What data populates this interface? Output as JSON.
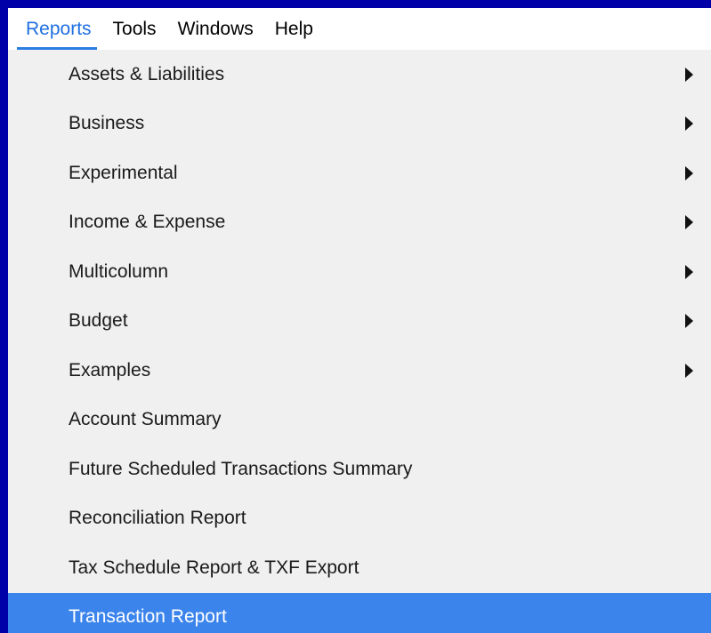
{
  "menubar": {
    "items": [
      {
        "label": "Reports",
        "active": true
      },
      {
        "label": "Tools",
        "active": false
      },
      {
        "label": "Windows",
        "active": false
      },
      {
        "label": "Help",
        "active": false
      }
    ]
  },
  "reports_menu": {
    "items": [
      {
        "label": "Assets & Liabilities",
        "has_submenu": true
      },
      {
        "label": "Business",
        "has_submenu": true
      },
      {
        "label": "Experimental",
        "has_submenu": true
      },
      {
        "label": "Income & Expense",
        "has_submenu": true
      },
      {
        "label": "Multicolumn",
        "has_submenu": true
      },
      {
        "label": "Budget",
        "has_submenu": true
      },
      {
        "label": "Examples",
        "has_submenu": true
      },
      {
        "label": "Account Summary",
        "has_submenu": false
      },
      {
        "label": "Future Scheduled Transactions Summary",
        "has_submenu": false
      },
      {
        "label": "Reconciliation Report",
        "has_submenu": false
      },
      {
        "label": "Tax Schedule Report & TXF Export",
        "has_submenu": false
      },
      {
        "label": "Transaction Report",
        "has_submenu": false,
        "highlighted": true
      }
    ],
    "submenu_icon": "chevron-right-icon"
  },
  "colors": {
    "desktop_background": "#0000a8",
    "menu_background": "#f0f0f0",
    "menubar_background": "#ffffff",
    "active_accent": "#2a7de1",
    "highlight": "#3b84ec"
  }
}
